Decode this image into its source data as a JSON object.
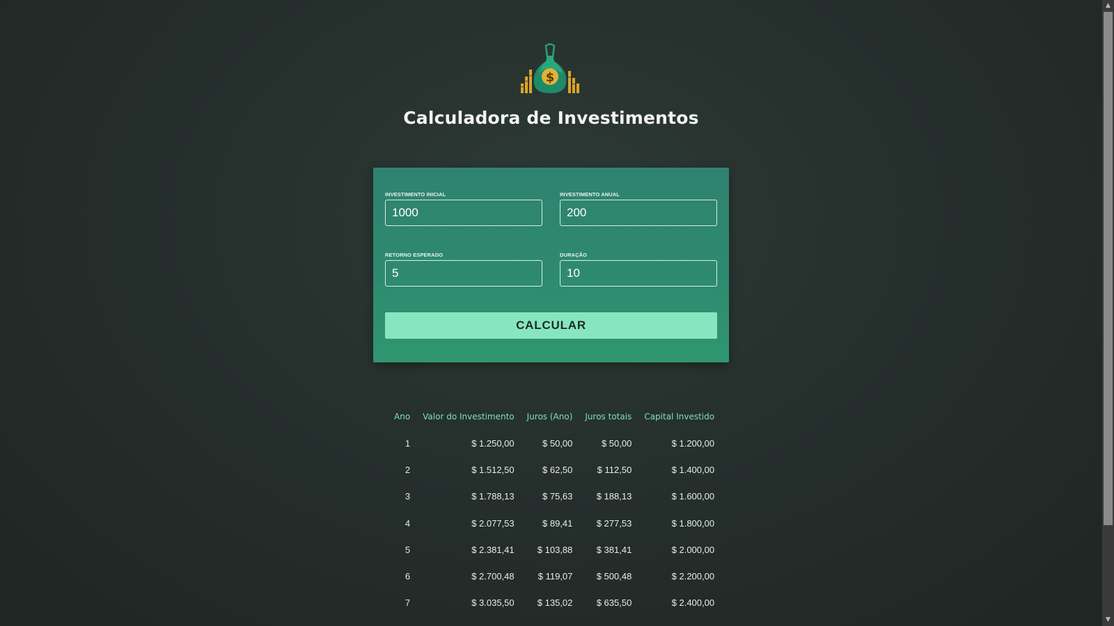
{
  "app": {
    "title": "Calculadora de Investimentos",
    "logo_icon": "money-bag-dollar-icon"
  },
  "form": {
    "initial_investment": {
      "label": "INVESTIMENTO INICIAL",
      "value": "1000"
    },
    "annual_investment": {
      "label": "INVESTIMENTO ANUAL",
      "value": "200"
    },
    "expected_return": {
      "label": "RETORNO ESPERADO",
      "value": "5"
    },
    "duration": {
      "label": "DURAÇÃO",
      "value": "10"
    },
    "calculate_label": "CALCULAR"
  },
  "table": {
    "headers": [
      "Ano",
      "Valor do Investimento",
      "Juros (Ano)",
      "Juros totais",
      "Capital Investido"
    ],
    "rows": [
      [
        "1",
        "$ 1.250,00",
        "$ 50,00",
        "$ 50,00",
        "$ 1.200,00"
      ],
      [
        "2",
        "$ 1.512,50",
        "$ 62,50",
        "$ 112,50",
        "$ 1.400,00"
      ],
      [
        "3",
        "$ 1.788,13",
        "$ 75,63",
        "$ 188,13",
        "$ 1.600,00"
      ],
      [
        "4",
        "$ 2.077,53",
        "$ 89,41",
        "$ 277,53",
        "$ 1.800,00"
      ],
      [
        "5",
        "$ 2.381,41",
        "$ 103,88",
        "$ 381,41",
        "$ 2.000,00"
      ],
      [
        "6",
        "$ 2.700,48",
        "$ 119,07",
        "$ 500,48",
        "$ 2.200,00"
      ],
      [
        "7",
        "$ 3.035,50",
        "$ 135,02",
        "$ 635,50",
        "$ 2.400,00"
      ]
    ]
  },
  "colors": {
    "background": "#26302d",
    "card": "#2e8a6f",
    "button": "#87e5c0",
    "header_text": "#7ee0b6"
  }
}
